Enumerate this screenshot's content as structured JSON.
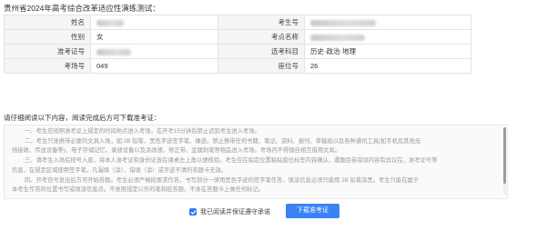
{
  "page_title": "贵州省2024年高考综合改革适应性演练测试：",
  "info": {
    "name_label": "姓名",
    "exam_no_label": "考生号",
    "gender_label": "性别",
    "gender_value": "女",
    "site_name_label": "考点名称",
    "admission_no_label": "准考证号",
    "subject_label": "选考科目",
    "subject_value": "历史·政治·地理",
    "room_no_label": "考场号",
    "room_no_value": "049",
    "seat_no_label": "座位号",
    "seat_no_value": "26"
  },
  "notice": {
    "heading": "请仔细阅读以下内容，阅读完成后方可下载准考证：",
    "paragraphs": [
      "一、考生应按照准考证上规定的时间地点进入考场，在开考15分钟后禁止迟到考生进入考场。",
      "二、考生只准携带必要的文具入场，如 2B 铅笔、黑色字迹签字笔、橡皮。禁止携带任何书籍、笔记、资料、报刊、草稿纸以及各种通讯工具(如手机及其他无",
      "线接收、传送设备等)、电子存储记忆、录放设备以及涂改液、修正带、金属刺笔等物品进入考场。考场内不得擅自相互借用文具。",
      "三、请考生入场后按号入座，将本人准考证和身份证放在课桌左上角以便核验。考生应在指定位置粘贴座位标签内容确认，遇题目卷错误内容有异议在，准考证号等",
      "信息，在规定区域使用签字笔，凡漏填（涂）、错填（涂）或字迹不清的答题卡无效。",
      "四、开考信号发出后方可开始答题。考生必须严格按要求作答，书写部分一律用黑色字迹的签字笔作答，填涂信息必须只能用 2B 铅笔涂黑。考生只能在属于",
      "本考生作答的位置书写或填涂信息点。不准用规定以外的笔和纸答题，不准在答题卡上做任何标记。"
    ]
  },
  "agree_label": "我已阅读并保证遵守承诺",
  "download_button": "下载准考证",
  "colors": {
    "accent": "#3b82f6",
    "checkbox": "#2f7bf5"
  }
}
